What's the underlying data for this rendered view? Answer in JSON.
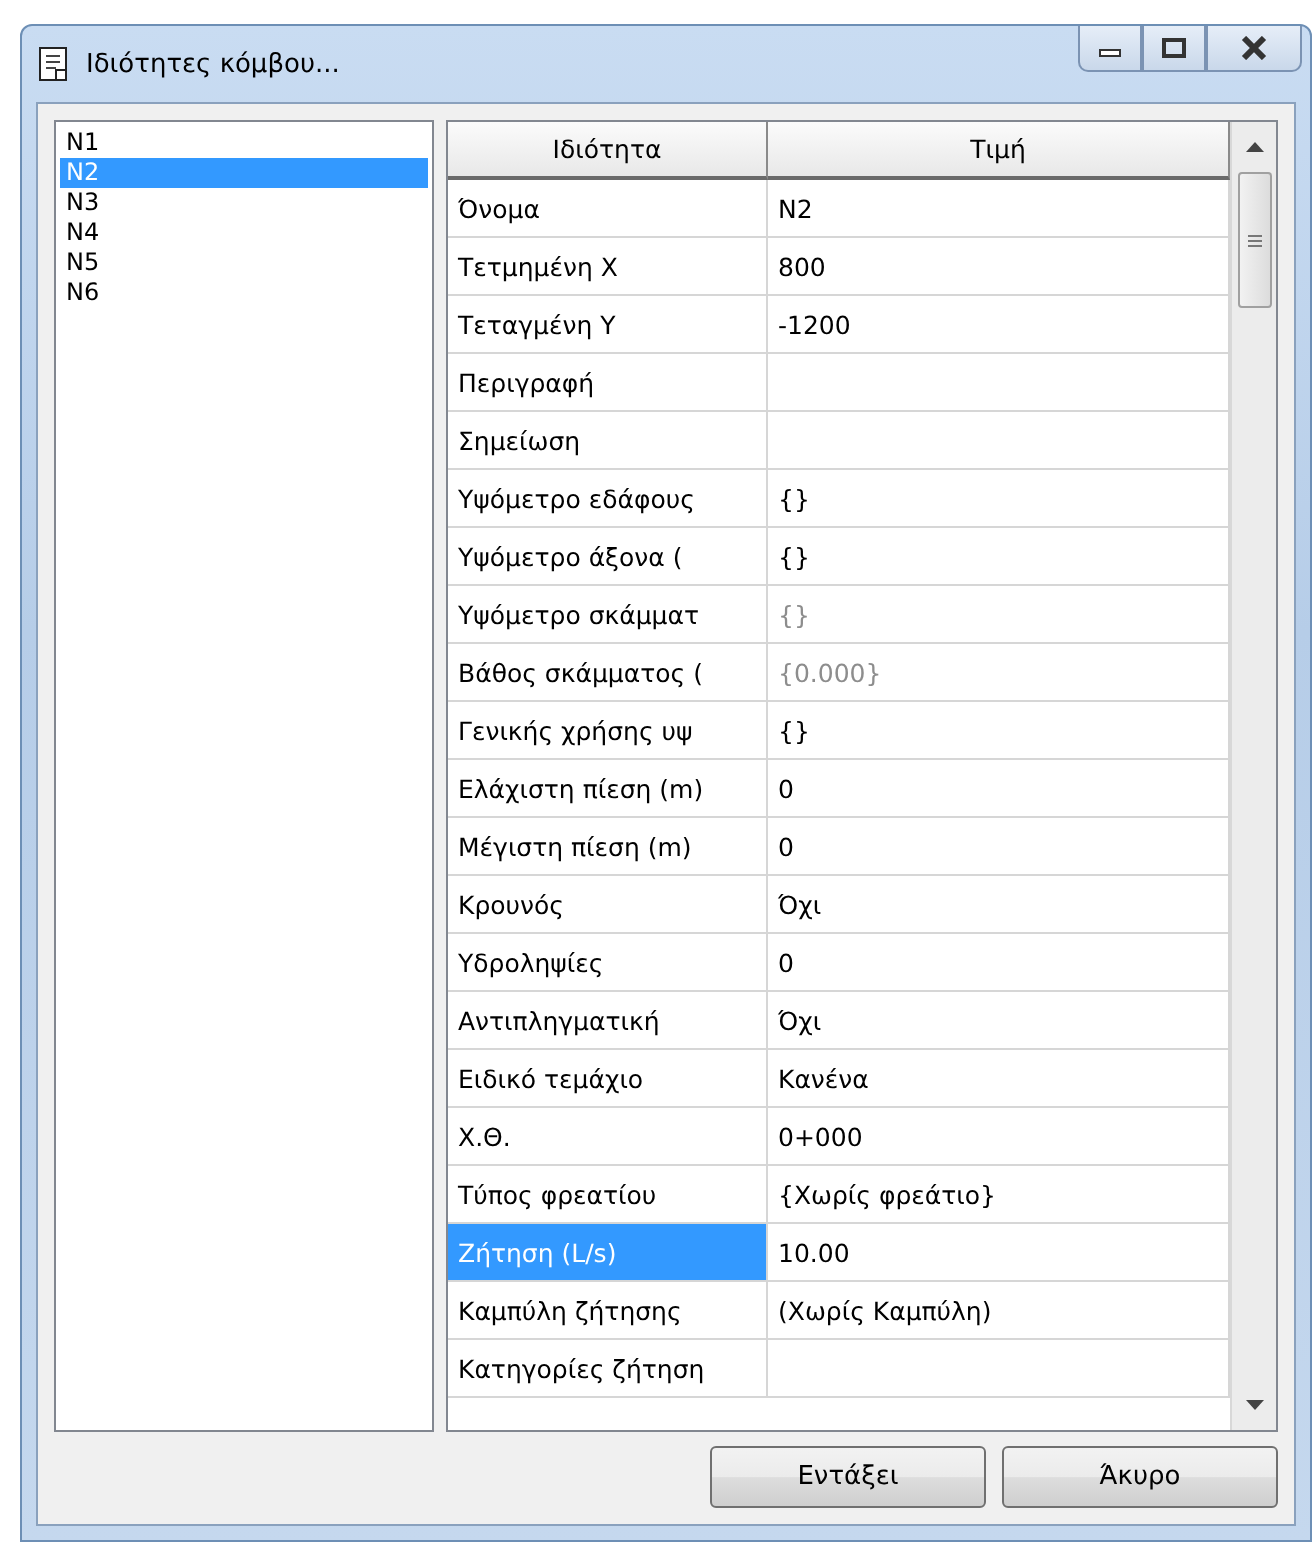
{
  "window": {
    "title": "Ιδιότητες κόμβου..."
  },
  "nodes": [
    {
      "label": "N1",
      "selected": false
    },
    {
      "label": "N2",
      "selected": true
    },
    {
      "label": "N3",
      "selected": false
    },
    {
      "label": "N4",
      "selected": false
    },
    {
      "label": "N5",
      "selected": false
    },
    {
      "label": "N6",
      "selected": false
    }
  ],
  "grid": {
    "columns": [
      "Ιδιότητα",
      "Τιμή"
    ],
    "rows": [
      {
        "property": "Όνομα",
        "value": "N2",
        "selected": false,
        "disabled": false
      },
      {
        "property": "Τετμημένη X",
        "value": "800",
        "selected": false,
        "disabled": false
      },
      {
        "property": "Τεταγμένη Y",
        "value": "-1200",
        "selected": false,
        "disabled": false
      },
      {
        "property": "Περιγραφή",
        "selected": false
      },
      {
        "property": "Σημείωση",
        "selected": false
      },
      {
        "property": "Υψόμετρο εδάφους",
        "value": "{}",
        "selected": false,
        "disabled": false
      },
      {
        "property": "Υψόμετρο άξονα (",
        "value": "{}",
        "selected": false,
        "disabled": false
      },
      {
        "property": "Υψόμετρο σκάμματ",
        "value": "{}",
        "selected": false,
        "disabled": true
      },
      {
        "property": "Βάθος σκάμματος (",
        "value": "{0.000}",
        "selected": false,
        "disabled": true
      },
      {
        "property": "Γενικής χρήσης υψ",
        "value": "{}",
        "selected": false,
        "disabled": false
      },
      {
        "property": "Ελάχιστη πίεση (m)",
        "value": "0",
        "selected": false,
        "disabled": false
      },
      {
        "property": "Μέγιστη πίεση (m)",
        "value": "0",
        "selected": false,
        "disabled": false
      },
      {
        "property": "Κρουνός",
        "value": "Όχι",
        "selected": false,
        "disabled": false
      },
      {
        "property": "Υδροληψίες",
        "value": "0",
        "selected": false,
        "disabled": false
      },
      {
        "property": "Αντιπληγματική",
        "value": "Όχι",
        "selected": false,
        "disabled": false
      },
      {
        "property": "Ειδικό τεμάχιο",
        "value": "Κανένα",
        "selected": false,
        "disabled": false
      },
      {
        "property": "Χ.Θ.",
        "value": "0+000",
        "selected": false,
        "disabled": false
      },
      {
        "property": "Τύπος φρεατίου",
        "value": "{Χωρίς φρεάτιο}",
        "selected": false,
        "disabled": false
      },
      {
        "property": "Ζήτηση (L/s)",
        "value": "10.00",
        "selected": true,
        "disabled": false
      },
      {
        "property": "Καμπύλη ζήτησης",
        "value": "(Χωρίς Καμπύλη)",
        "selected": false,
        "disabled": false
      },
      {
        "property": "Κατηγορίες ζήτηση",
        "selected": false
      }
    ]
  },
  "buttons": [
    "Εντάξει",
    "Άκυρο"
  ]
}
